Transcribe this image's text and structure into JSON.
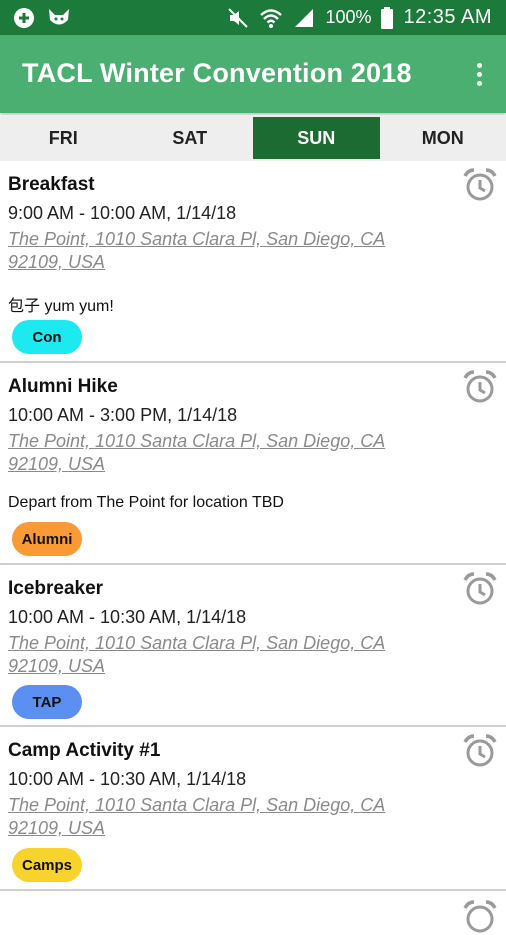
{
  "status_bar": {
    "battery": "100%",
    "time": "12:35 AM",
    "icons": [
      "app-notification-icon",
      "fox-notification-icon",
      "mute-icon",
      "wifi-icon",
      "signal-icon",
      "battery-icon"
    ]
  },
  "app_bar": {
    "title": "TACL Winter Convention 2018",
    "menu_icon": "overflow-menu-icon"
  },
  "tabs": [
    {
      "label": "FRI",
      "active": false
    },
    {
      "label": "SAT",
      "active": false
    },
    {
      "label": "SUN",
      "active": true
    },
    {
      "label": "MON",
      "active": false
    }
  ],
  "events": [
    {
      "title": "Breakfast",
      "time": "9:00 AM - 10:00 AM, 1/14/18",
      "location_line1": "The Point, 1010 Santa Clara Pl, San Diego, CA",
      "location_line2": "92109, USA",
      "description": "包子 yum yum!",
      "tag": "Con",
      "tag_color": "#1de9f0"
    },
    {
      "title": "Alumni Hike",
      "time": "10:00 AM - 3:00 PM, 1/14/18",
      "location_line1": "The Point, 1010 Santa Clara Pl, San Diego, CA",
      "location_line2": "92109, USA",
      "description": "Depart from The Point for location TBD",
      "tag": "Alumni",
      "tag_color": "#f99a36"
    },
    {
      "title": "Icebreaker",
      "time": "10:00 AM - 10:30 AM, 1/14/18",
      "location_line1": "The Point, 1010 Santa Clara Pl, San Diego, CA",
      "location_line2": "92109, USA",
      "description": "",
      "tag": "TAP",
      "tag_color": "#5b8ff2"
    },
    {
      "title": "Camp Activity #1",
      "time": "10:00 AM - 10:30 AM, 1/14/18",
      "location_line1": "The Point, 1010 Santa Clara Pl, San Diego, CA",
      "location_line2": "92109, USA",
      "description": "",
      "tag": "Camps",
      "tag_color": "#f7d32d"
    }
  ],
  "colors": {
    "status_bar": "#1c7a3a",
    "app_bar": "#4caf72",
    "active_tab": "#1c6b33",
    "tab_strip": "#eeeeee",
    "location_text": "#8a8a8a"
  }
}
